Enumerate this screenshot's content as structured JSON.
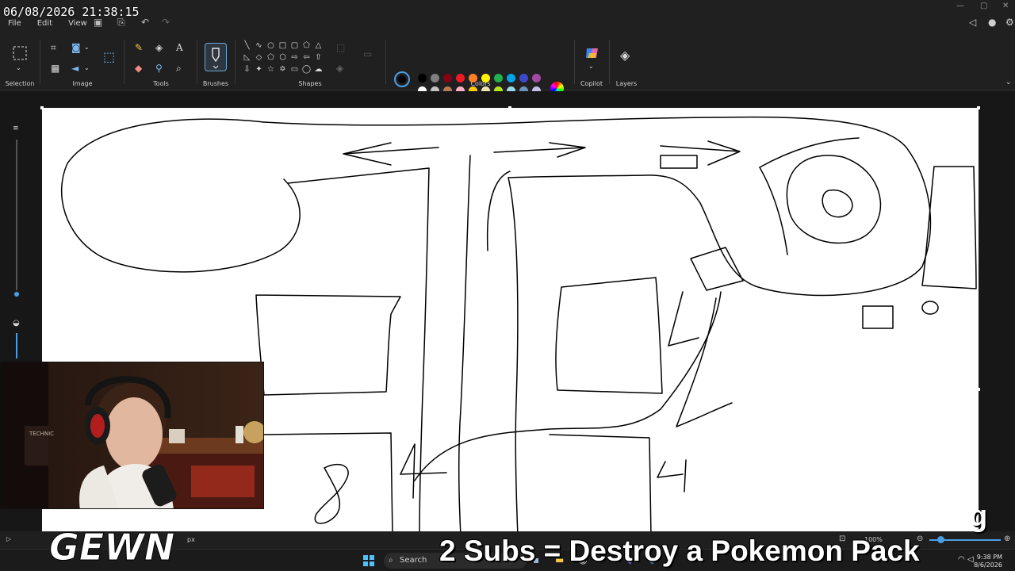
{
  "overlay": {
    "timestamp": "06/08/2026 21:38:15",
    "banner_text": "2 Subs = Destroy a Pokemon Pack",
    "ghost_text": "",
    "ghost_letter": "g",
    "logo_text": "GEWN"
  },
  "menu": {
    "file": "File",
    "edit": "Edit",
    "view": "View"
  },
  "ribbon": {
    "groups": {
      "selection": "Selection",
      "image": "Image",
      "tools": "Tools",
      "brushes": "Brushes",
      "shapes": "Shapes",
      "colors": "Colors",
      "copilot": "Copilot",
      "layers": "Layers"
    },
    "primary_color": "#000000",
    "secondary_color": "#ffffff",
    "palette_row1": [
      "#000000",
      "#7f7f7f",
      "#880015",
      "#ed1c24",
      "#ff7f27",
      "#fff200",
      "#22b14c",
      "#00a2e8",
      "#3f48cc",
      "#a349a4"
    ],
    "palette_row2": [
      "#ffffff",
      "#c3c3c3",
      "#b97a57",
      "#ffaec9",
      "#ffc90e",
      "#efe4b0",
      "#b5e61d",
      "#99d9ea",
      "#7092be",
      "#c8bfe7"
    ]
  },
  "statusbar": {
    "size_suffix": "px",
    "zoom": "100%"
  },
  "taskbar": {
    "search_placeholder": "Search",
    "time": "9:38 PM",
    "date": "8/6/2026"
  },
  "canvas": {
    "drawn_digits": [
      "8",
      "4",
      "4"
    ]
  }
}
